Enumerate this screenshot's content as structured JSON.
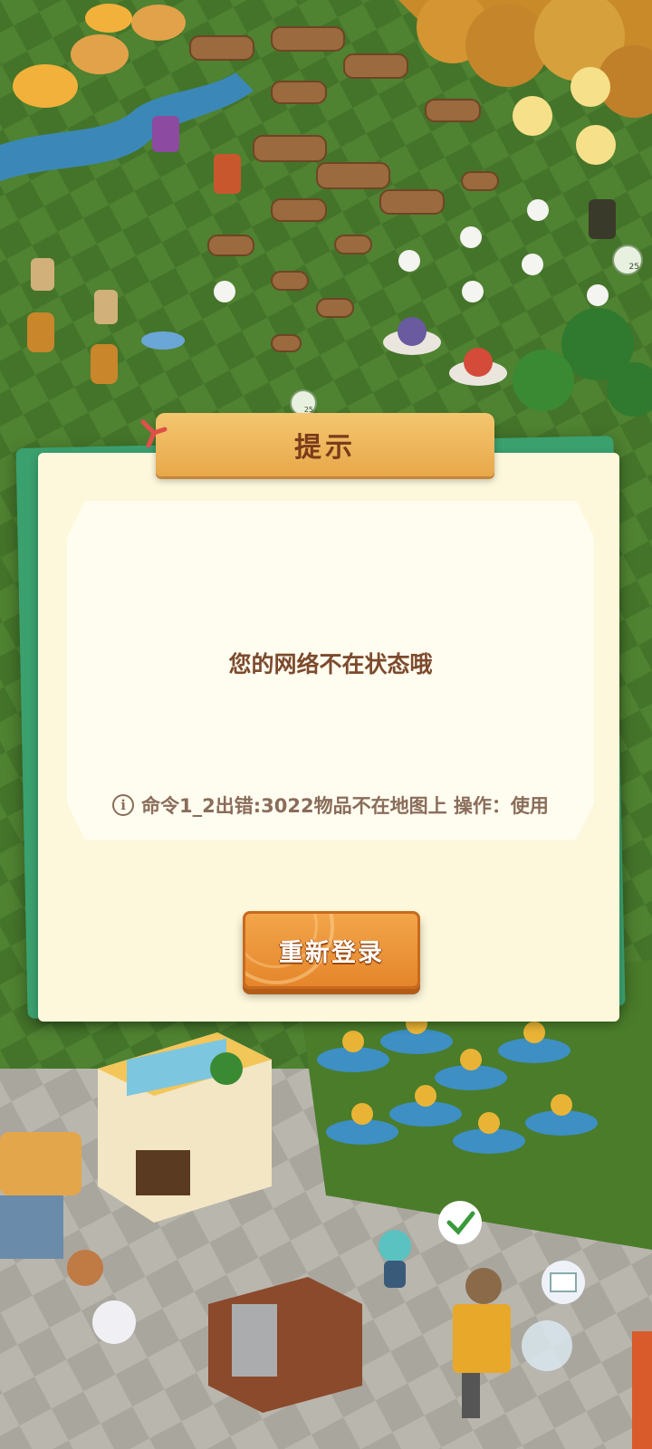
{
  "dialog": {
    "title": "提示",
    "message": "您的网络不在状态哦",
    "error_text": "命令1_2出错:3022物品不在地图上 操作：使用",
    "button_label": "重新登录"
  },
  "hud": {
    "badge_count_1": "25",
    "badge_count_2": "25"
  },
  "icons": {
    "info": "info-circle-icon",
    "ribbon": "ribbon-icon",
    "check": "check-bubble-icon",
    "mail": "mail-bubble-icon",
    "leaf": "leaf-icon"
  },
  "colors": {
    "dialog_bg": "#fdf8dc",
    "title_tab": "#e8a84a",
    "title_text": "#7a3c1a",
    "button": "#e5862b",
    "dialog_border": "#3aa06e",
    "grass_dark": "#3f6a24",
    "grass_light": "#5a8a30"
  }
}
